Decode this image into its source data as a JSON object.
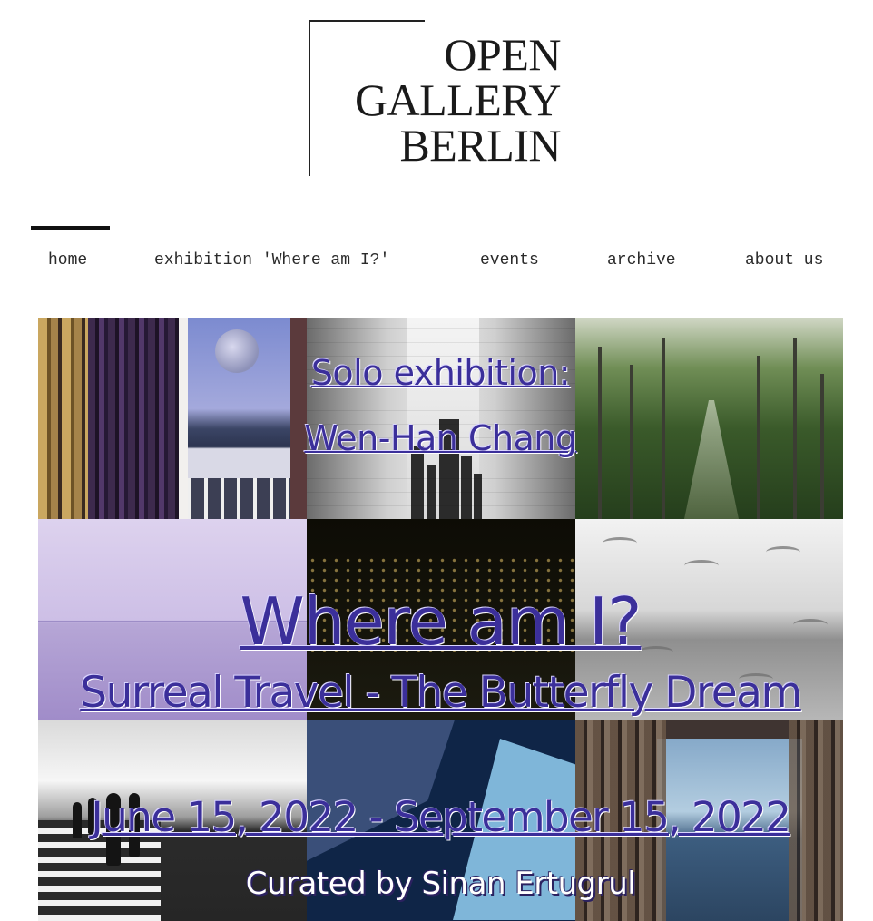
{
  "logo": {
    "line1": "OPEN",
    "line2": "GALLERY",
    "line3": "BERLIN"
  },
  "nav": {
    "items": [
      {
        "label": "home",
        "active": true
      },
      {
        "label": "exhibition 'Where am I?'"
      },
      {
        "label": "events"
      },
      {
        "label": "archive"
      },
      {
        "label": "about us"
      }
    ]
  },
  "hero": {
    "solo_label": "Solo exhibition:",
    "artist": "Wen-Han Chang",
    "title": "Where am I?",
    "subtitle": "Surreal Travel - The Butterfly Dream",
    "dates": "June 15, 2022 - September 15, 2022",
    "curator": "Curated by Sinan Ertugrul"
  },
  "colors": {
    "link": "#3b2f9a",
    "nav_text": "#2a2a2a",
    "indicator": "#111111",
    "background": "#ffffff"
  }
}
